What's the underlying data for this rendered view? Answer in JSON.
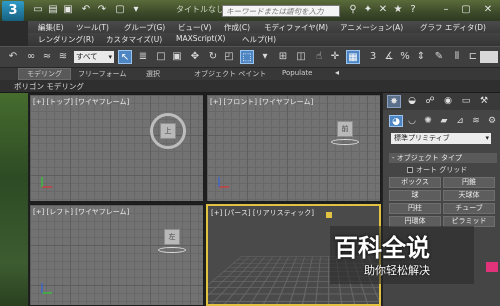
{
  "window": {
    "title": "タイトルなし",
    "search_placeholder": "キーワードまたは語句を入力",
    "logo_text": "3"
  },
  "menu_row1": [
    "編集(E)",
    "ツール(T)",
    "グループ(G)",
    "ビュー(V)",
    "作成(C)",
    "モディファイヤ(M)",
    "アニメーション(A)",
    "グラフ エディタ(D)"
  ],
  "menu_row2": [
    "レンダリング(R)",
    "カスタマイズ(U)",
    "MAXScript(X)",
    "ヘルプ(H)"
  ],
  "toolbar": {
    "selection_filter": "すべて"
  },
  "ribbon": {
    "tabs": [
      "モデリング",
      "フリーフォーム",
      "選択",
      "オブジェクト ペイント",
      "Populate"
    ],
    "subtitle": "ポリゴン モデリング"
  },
  "viewports": {
    "top": "[+] [トップ] [ワイヤフレーム]",
    "front": "[+] [フロント] [ワイヤフレーム]",
    "left": "[+] [レフト] [ワイヤフレーム]",
    "perspective": "[+] [パース] [リアリスティック]",
    "cube_top": "上",
    "cube_front": "前",
    "cube_left": "左"
  },
  "command_panel": {
    "category_dropdown": "標準プリミティブ",
    "rollout_title": "- オブジェクト タイプ",
    "autogrid_label": "オート グリッド",
    "buttons": [
      "ボックス",
      "円錐",
      "球",
      "天球体",
      "円柱",
      "チューブ",
      "円環体",
      "ピラミッド"
    ]
  },
  "watermark": {
    "main": "百科全说",
    "sub": "助你轻松解决"
  },
  "colors": {
    "accent": "#4e86c4",
    "persp_border": "#e2c341",
    "watermark_badge": "#e0337a"
  }
}
